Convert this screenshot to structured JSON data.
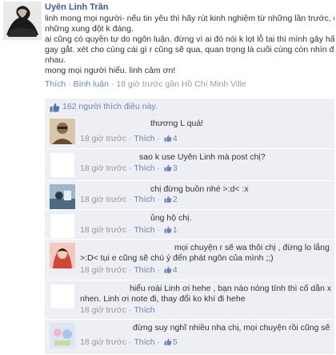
{
  "post": {
    "author": "Uyên Linh Trần",
    "message_lines": [
      "linh mong mọi người- nếu tin yêu thì hãy rút kinh nghiệm từ những lần trước, đã có",
      "những xung đột k đáng.",
      "ai cũng có quyền tự do ngôn luận. đừng vì ai đó nói k lọt lỗ tai thì mình gây hấn v",
      "gay gắt. xét cho cùng cái gì r cũng sẽ qua, quan trọng là cuối cùng còn nhìn đc mặt",
      "nhau.",
      "mong mọi người hiểu. linh cảm ơn!"
    ],
    "like_link": "Thích",
    "comment_link": "Bình luận",
    "timestamp": "18 giờ trước gần Hồ Chí Minh Ville",
    "likes_text": "162 người thích điều này."
  },
  "comments": [
    {
      "lines": [
        "thương L quá!"
      ],
      "time": "18 giờ trước",
      "like": "Thích",
      "count": "4"
    },
    {
      "lines": [
        "sao k use Uyên Linh mà post chị?"
      ],
      "time": "18 giờ trước",
      "like": "Thích",
      "count": "3"
    },
    {
      "lines": [
        "chị đừng buồn nhé >:d< :x"
      ],
      "time": "18 giờ trước",
      "like": "Thích",
      "count": "2"
    },
    {
      "lines": [
        "ủng hộ chị."
      ],
      "time": "18 giờ trước",
      "like": "Thích",
      "count": "1"
    },
    {
      "lines": [
        "mọi chuyện r sẽ wa thôi chị , đừng lo lắng wá c nhớ",
        ">:D< tụi e cũng sẽ chú ý đến phát ngôn của mình ;;)"
      ],
      "time": "18 giờ trước",
      "like": "Thích",
      "count": "4"
    },
    {
      "lines": [
        "hiểu roài Linh ơi hehe , bạn nào nóng tính thì cố dằn xuống",
        "nhen. Linh ơi note đi, thay đổi ko khí đi hehe"
      ],
      "time": "18 giờ trước",
      "like": "Thích",
      "count": ""
    },
    {
      "lines": [
        "đừng suy nghĩ nhiều nha chị, mọi chuyện rồi cũng sẽ qua"
      ],
      "time": "18 giờ trước",
      "like": "Thích",
      "count": "5"
    }
  ],
  "separator": "·",
  "colors": {
    "link": "#3b5998",
    "secondary_link": "#6d84b4",
    "meta": "#999999",
    "panel": "#edeff4"
  }
}
